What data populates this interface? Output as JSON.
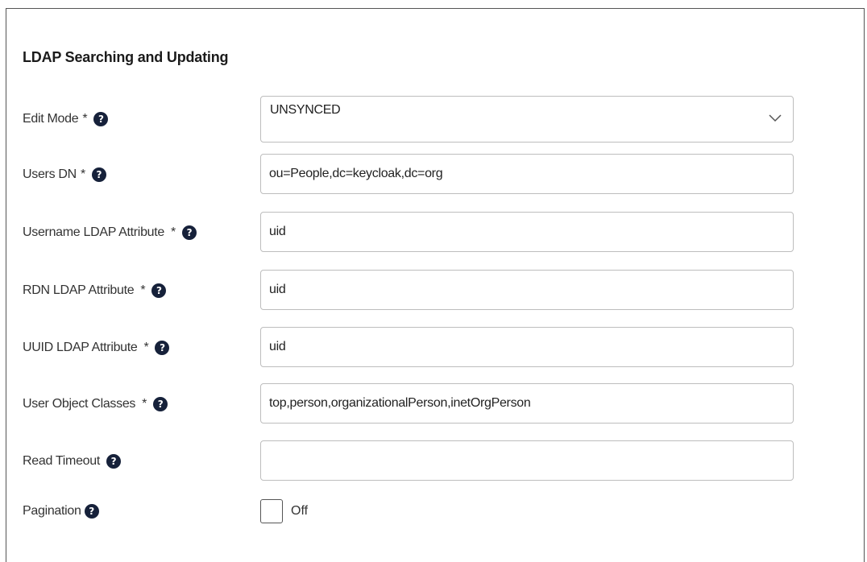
{
  "section": {
    "title": "LDAP Searching and Updating"
  },
  "fields": {
    "edit_mode": {
      "label": "Edit Mode",
      "required": "*",
      "value": "UNSYNCED",
      "help_icon": "question-circle-icon"
    },
    "users_dn": {
      "label": "Users DN",
      "required": "*",
      "value": "ou=People,dc=keycloak,dc=org",
      "help_icon": "question-circle-icon"
    },
    "username_ldap_attribute": {
      "label": "Username LDAP Attribute",
      "required": "*",
      "value": "uid",
      "help_icon": "question-circle-icon"
    },
    "rdn_ldap_attribute": {
      "label": "RDN LDAP Attribute",
      "required": "*",
      "value": "uid",
      "help_icon": "question-circle-icon"
    },
    "uuid_ldap_attribute": {
      "label": "UUID LDAP Attribute",
      "required": "*",
      "value": "uid",
      "help_icon": "question-circle-icon"
    },
    "user_object_classes": {
      "label": "User Object Classes",
      "required": "*",
      "value": "top,person,organizationalPerson,inetOrgPerson",
      "help_icon": "question-circle-icon"
    },
    "read_timeout": {
      "label": "Read Timeout",
      "value": "",
      "help_icon": "question-circle-icon"
    },
    "pagination": {
      "label": "Pagination",
      "state": "Off",
      "help_icon": "question-circle-icon"
    }
  },
  "colors": {
    "help_icon_bg": "#16213a",
    "border": "#bdbdbd"
  },
  "help_glyph": "?"
}
